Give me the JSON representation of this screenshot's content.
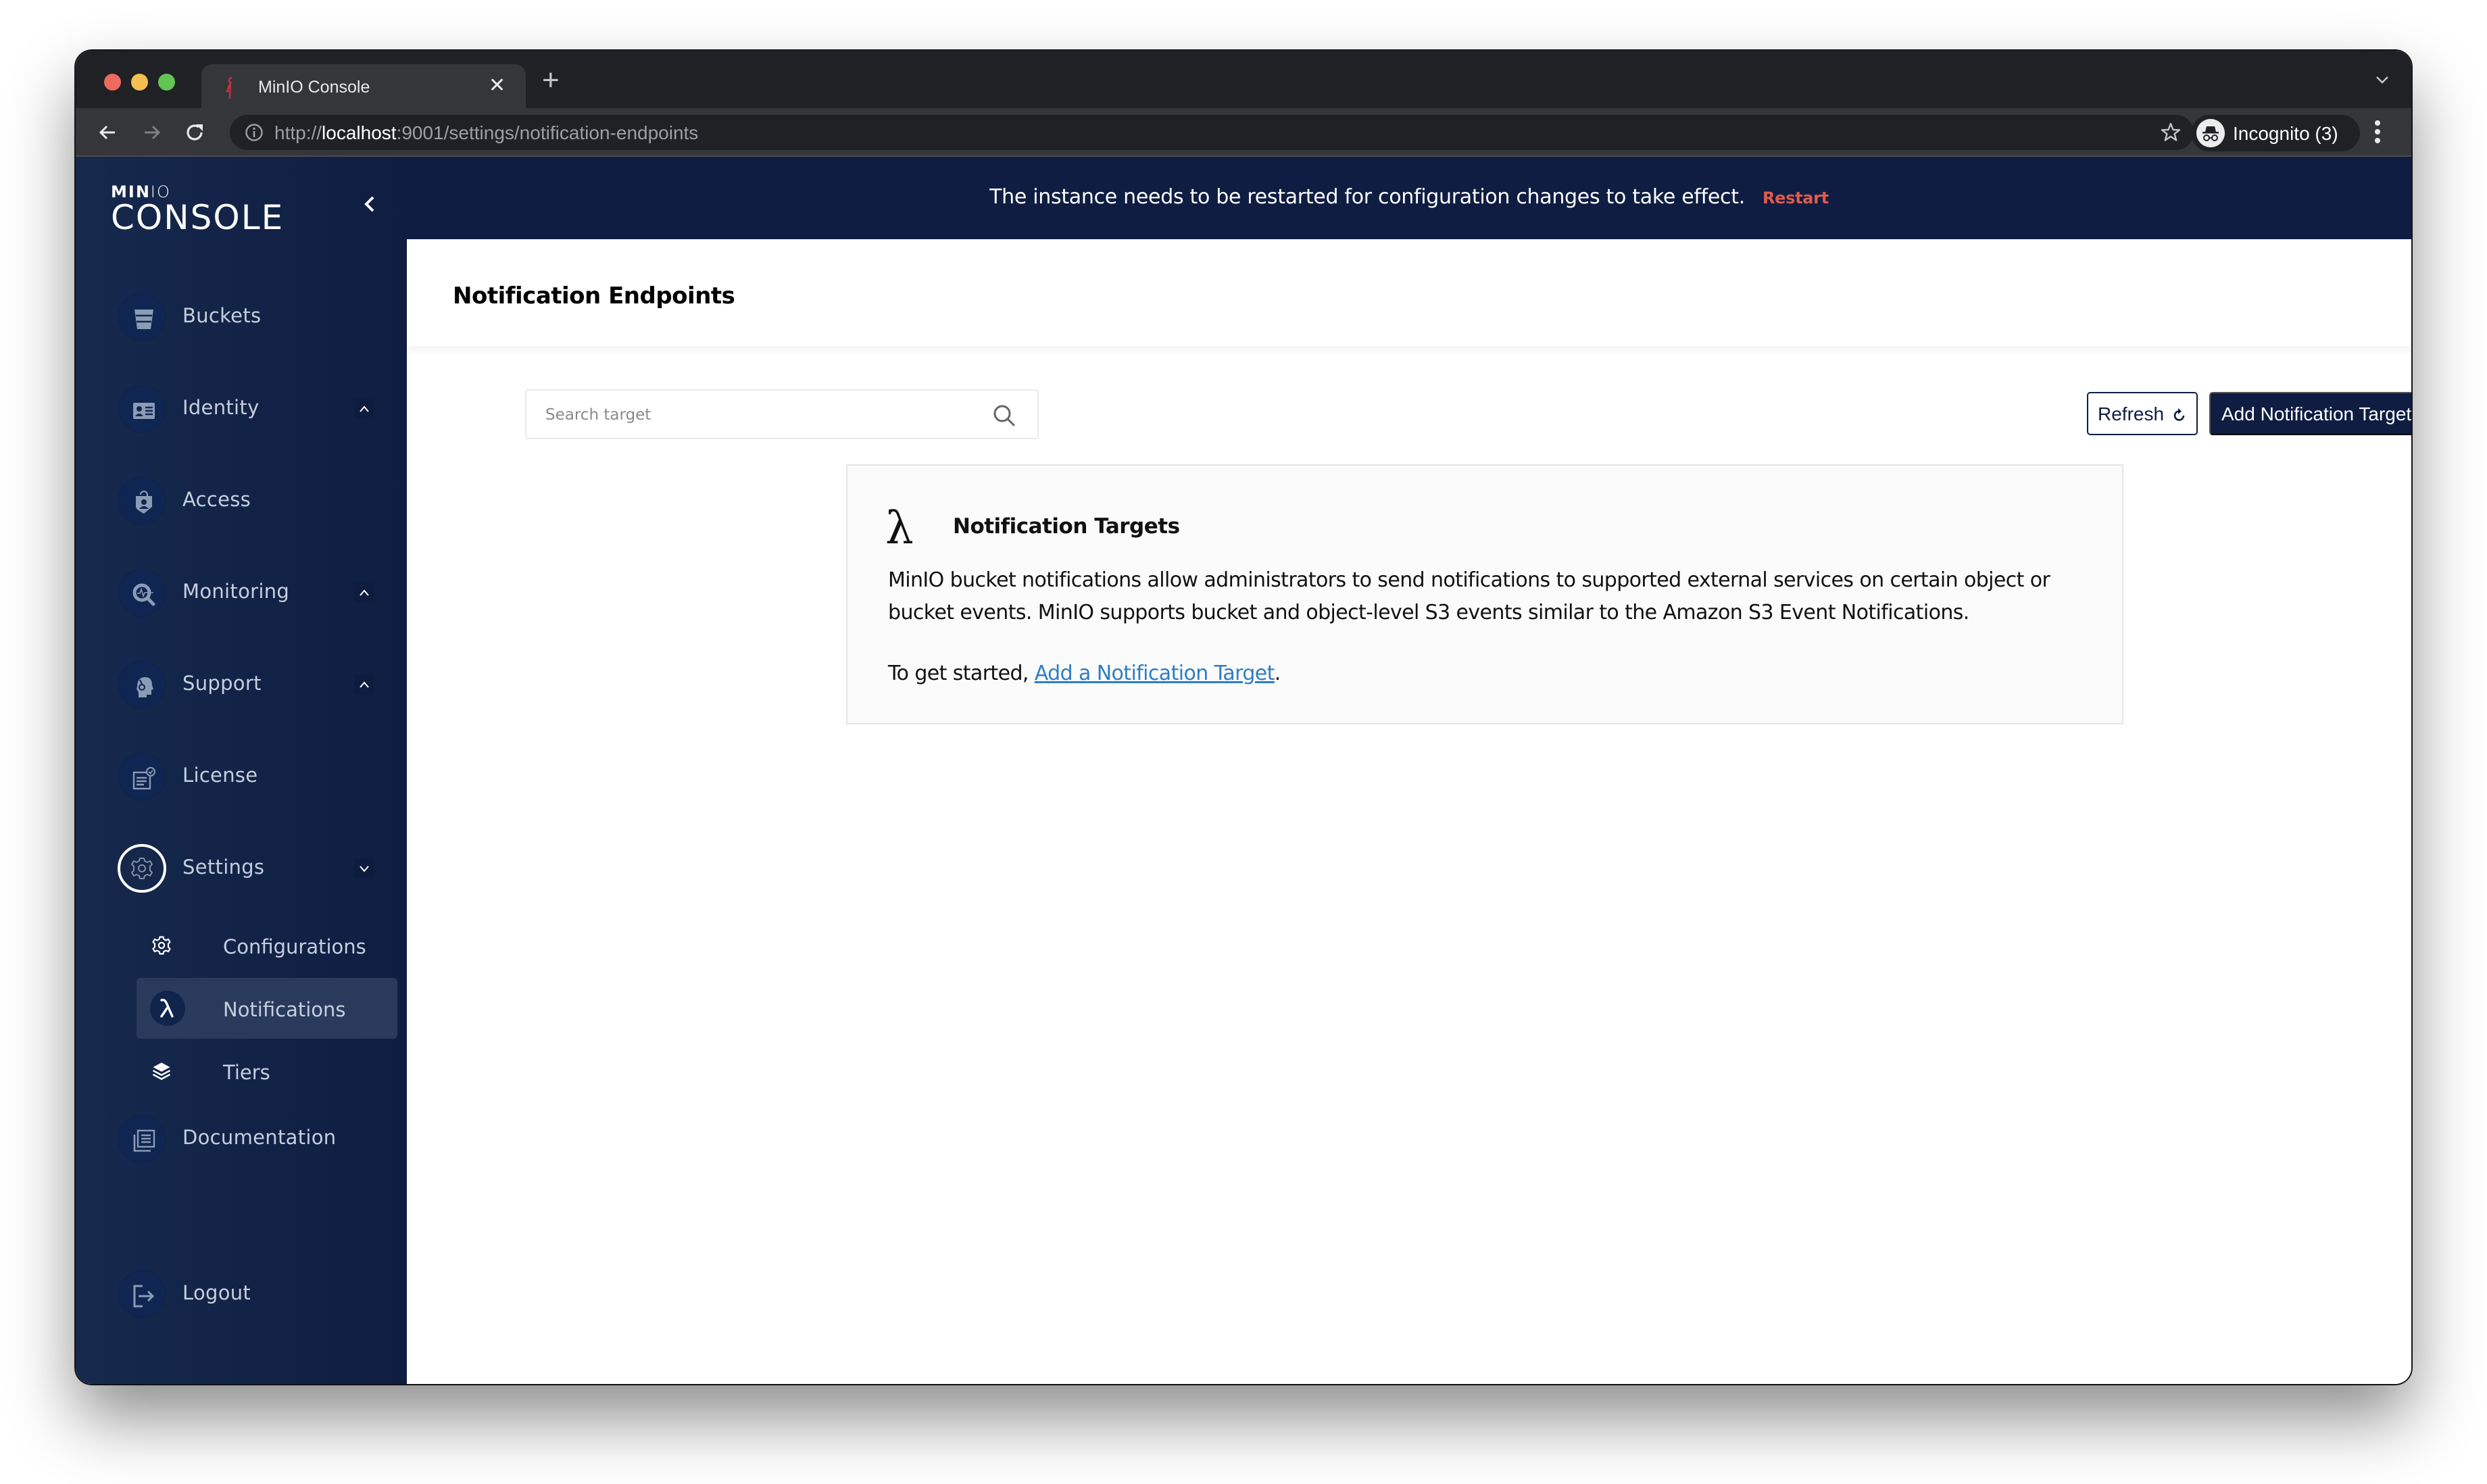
{
  "browser": {
    "tab_title": "MinIO Console",
    "url_scheme": "http://",
    "url_host": "localhost",
    "url_path": ":9001/settings/notification-endpoints",
    "profile_label": "Incognito (3)",
    "favicon_color": "#c8303f"
  },
  "sidebar": {
    "logo_top": "MIN",
    "logo_top_light": "IO",
    "logo_bottom": "CONSOLE",
    "items": [
      {
        "label": "Buckets",
        "icon": "bucket-icon"
      },
      {
        "label": "Identity",
        "icon": "identity-card-icon",
        "expand": "up"
      },
      {
        "label": "Access",
        "icon": "shield-user-icon"
      },
      {
        "label": "Monitoring",
        "icon": "monitoring-search-icon",
        "expand": "up"
      },
      {
        "label": "Support",
        "icon": "support-headset-icon",
        "expand": "up"
      },
      {
        "label": "License",
        "icon": "license-icon"
      },
      {
        "label": "Settings",
        "icon": "gear-icon",
        "expand": "down",
        "active": true
      },
      {
        "label": "Documentation",
        "icon": "documentation-icon"
      },
      {
        "label": "Logout",
        "icon": "logout-icon"
      }
    ],
    "settings_children": [
      {
        "label": "Configurations",
        "icon": "gear-icon"
      },
      {
        "label": "Notifications",
        "icon": "lambda-icon",
        "selected": true
      },
      {
        "label": "Tiers",
        "icon": "layers-icon"
      }
    ]
  },
  "banner": {
    "message": "The instance needs to be restarted for configuration changes to take effect.",
    "action_label": "Restart",
    "action_color": "#e05b4c"
  },
  "page": {
    "title": "Notification Endpoints",
    "search_placeholder": "Search target",
    "search_value": "",
    "refresh_label": "Refresh",
    "add_label": "Add Notification Target"
  },
  "card": {
    "icon": "λ",
    "title": "Notification Targets",
    "body": "MinIO bucket notifications allow administrators to send notifications to supported external services on certain object or bucket events. MinIO supports bucket and object-level S3 events similar to the Amazon S3 Event Notifications.",
    "cta_prefix": "To get started, ",
    "cta_link": "Add a Notification Target",
    "cta_suffix": "."
  },
  "colors": {
    "navy": "#0f1d42",
    "sidebar_gradient_start": "#16294d",
    "link": "#2f7dc4"
  }
}
